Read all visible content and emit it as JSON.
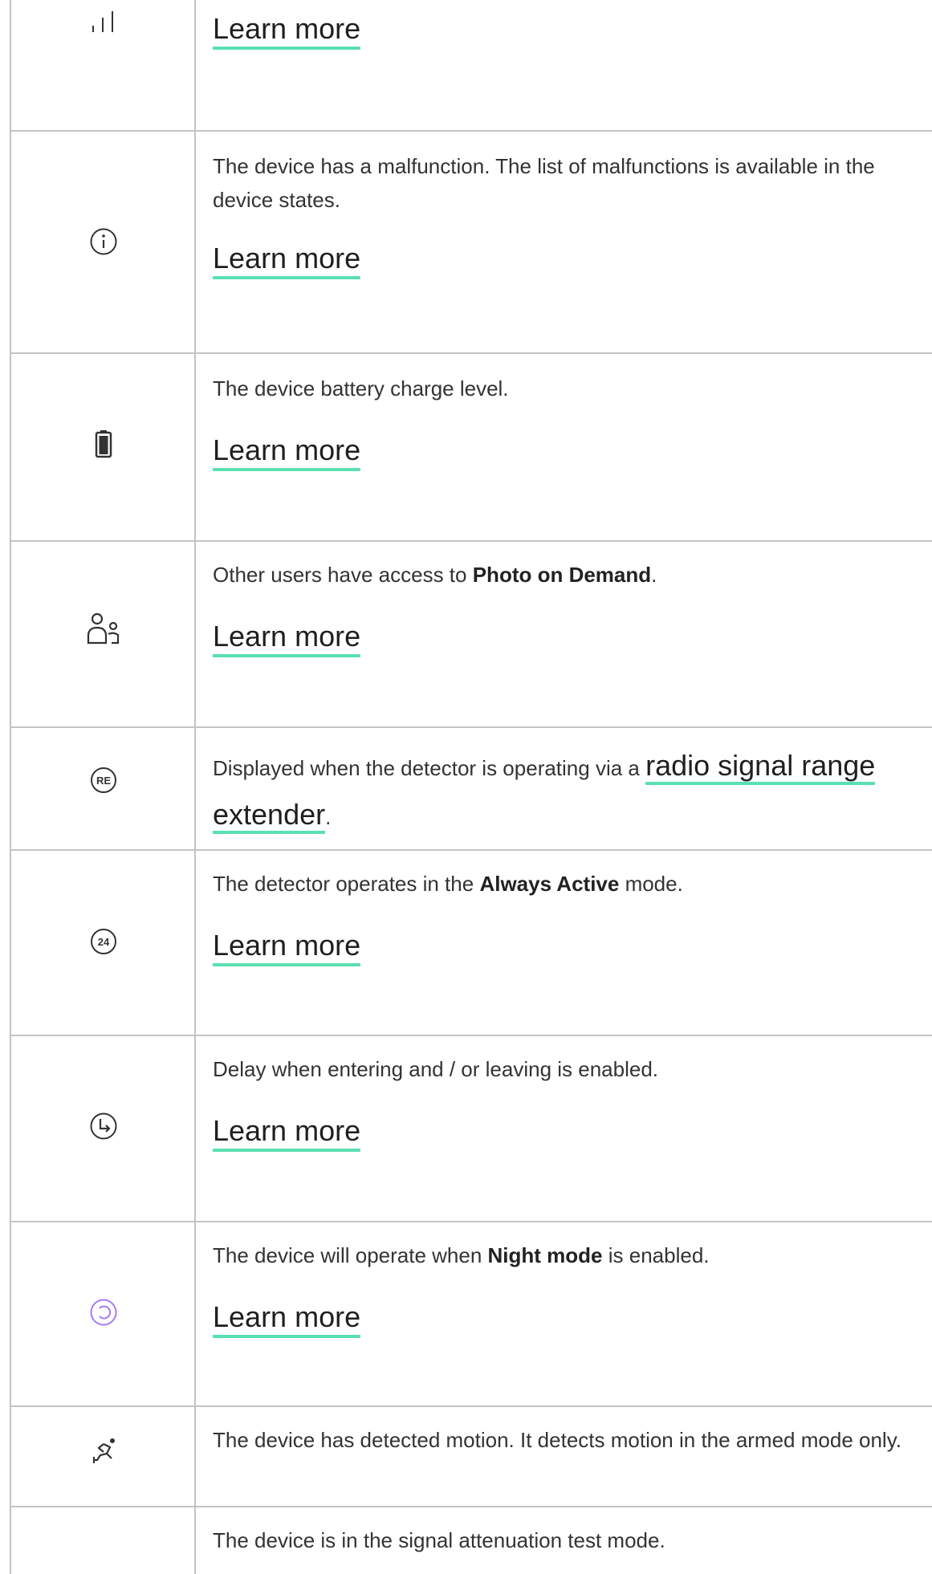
{
  "rows": [
    {
      "icon": "signal-strength-icon",
      "learn_more": "Learn more"
    },
    {
      "icon": "info-circle-icon",
      "text": "The device has a malfunction. The list of malfunctions is available in the device states.",
      "learn_more": "Learn more"
    },
    {
      "icon": "battery-icon",
      "text": "The device battery charge level.",
      "learn_more": "Learn more"
    },
    {
      "icon": "shared-users-icon",
      "text_before": "Other users have access to ",
      "bold": "Photo on Demand",
      "text_after": ".",
      "learn_more": "Learn more"
    },
    {
      "icon": "re-badge-icon",
      "text_before": "Displayed when the detector is operating via a ",
      "link": "radio signal range extender",
      "text_after": "."
    },
    {
      "icon": "always-active-24-icon",
      "text_before": "The detector operates in the ",
      "bold": "Always Active",
      "text_after": " mode.",
      "learn_more": "Learn more"
    },
    {
      "icon": "delay-clock-icon",
      "text": "Delay when entering and / or leaving is enabled.",
      "learn_more": "Learn more"
    },
    {
      "icon": "night-mode-icon",
      "text_before": "The device will operate when ",
      "bold": "Night mode",
      "text_after": " is enabled.",
      "learn_more": "Learn more"
    },
    {
      "icon": "motion-detected-icon",
      "text": "The device has detected motion. It detects motion in the armed mode only."
    },
    {
      "text": "The device is in the signal attenuation test mode."
    }
  ],
  "colors": {
    "link_underline": "#5be0b0",
    "night_mode_icon": "#a57cf0",
    "border": "#c4c4c4"
  }
}
